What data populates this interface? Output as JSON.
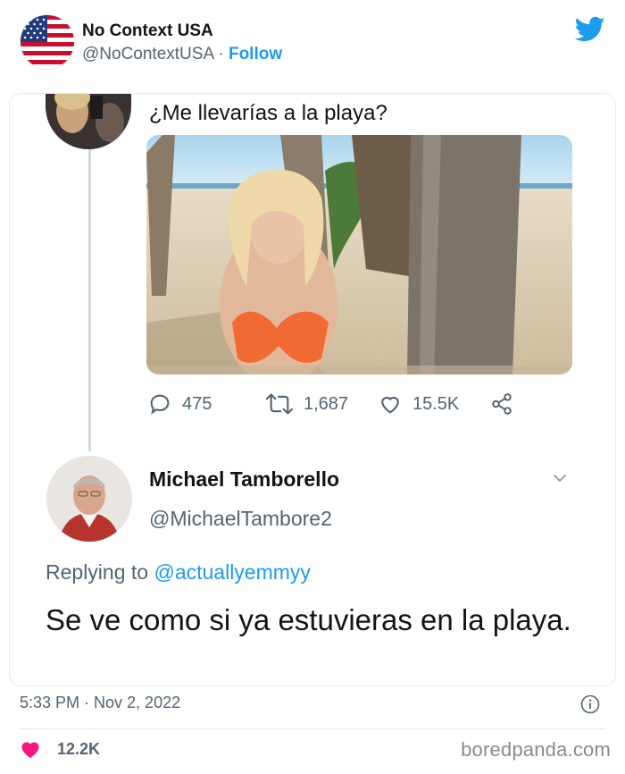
{
  "outer_tweet": {
    "account_name": "No Context USA",
    "handle": "@NoContextUSA",
    "separator": "·",
    "follow_label": "Follow",
    "timestamp": "5:33 PM · Nov 2, 2022",
    "like_count": "12.2K",
    "icons": [
      "us-flag-icon",
      "twitter-bird-icon",
      "info-icon",
      "heart-icon"
    ]
  },
  "screenshot": {
    "original_tweet": {
      "text": "¿Me llevarías a la playa?",
      "stats": {
        "replies": "475",
        "retweets": "1,687",
        "likes": "15.5K"
      }
    },
    "reply": {
      "name": "Michael Tamborello",
      "handle": "@MichaelTambore2",
      "replying_prefix": "Replying to",
      "replying_to": "@actuallyemmyy",
      "text": "Se ve como si ya estuvieras en la playa."
    }
  },
  "watermark": "boredpanda.com",
  "colors": {
    "accent": "#1d9bf0",
    "text": "#0f1419",
    "muted": "#536471",
    "heart": "#f91880"
  }
}
